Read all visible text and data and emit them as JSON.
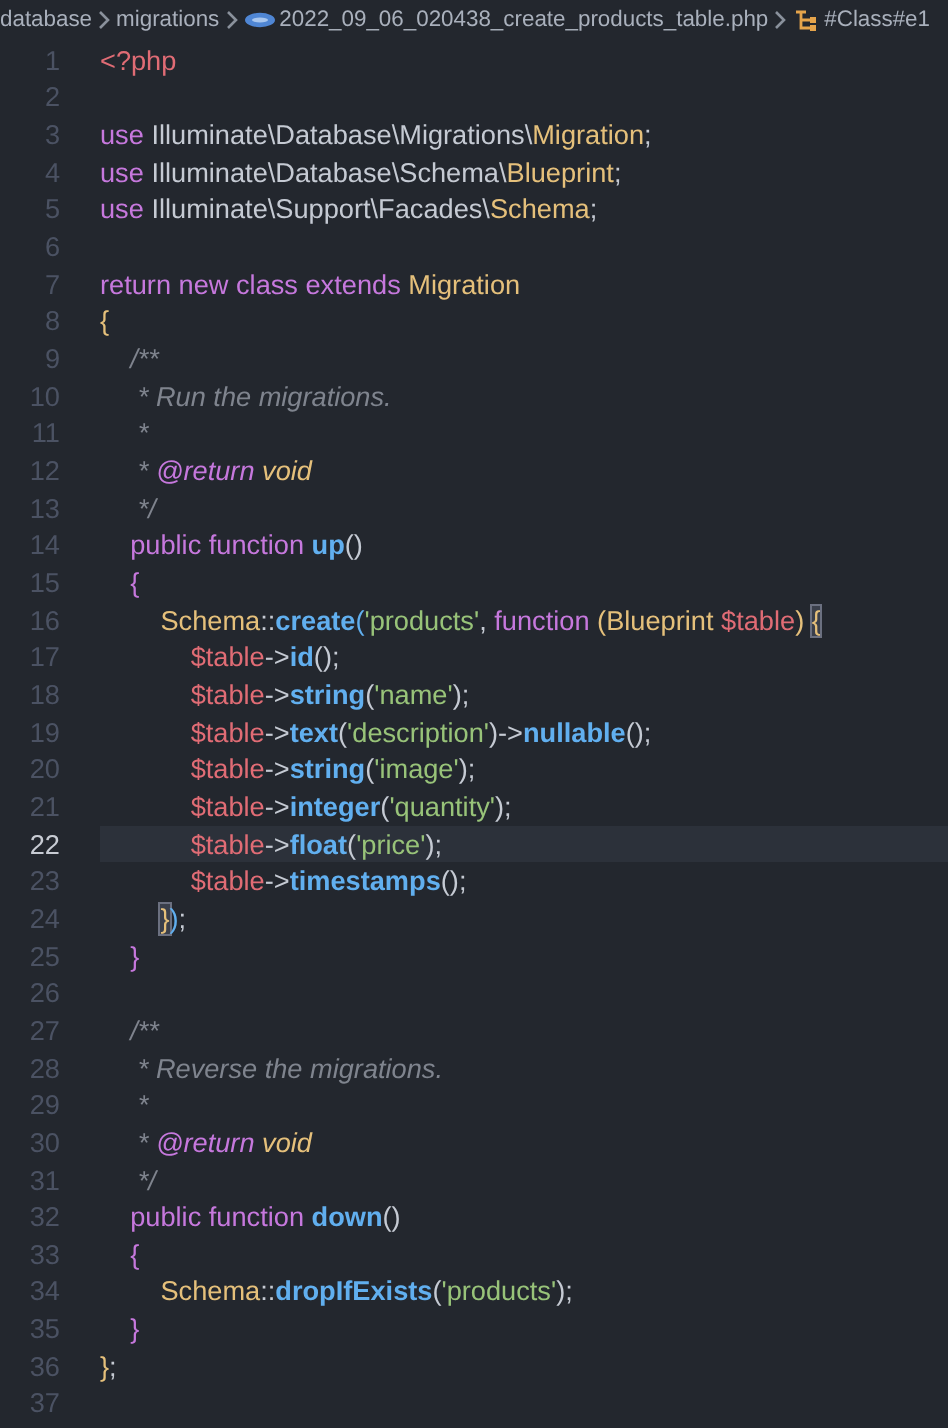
{
  "breadcrumb": [
    {
      "text": "database",
      "kind": "folder"
    },
    {
      "text": "migrations",
      "kind": "folder"
    },
    {
      "text": "2022_09_06_020438_create_products_table.php",
      "kind": "file"
    },
    {
      "text": "#Class#e1",
      "kind": "symbol"
    }
  ],
  "lines": [
    {
      "number": "1",
      "current": false,
      "tokens": [
        {
          "text": "<?php",
          "kind": "tag"
        }
      ]
    },
    {
      "number": "2",
      "current": false
    },
    {
      "number": "3",
      "current": false,
      "tokens": [
        {
          "text": "use",
          "kind": "kw"
        },
        {
          "text": " Illuminate\\Database\\Migrations\\",
          "kind": "plain"
        },
        {
          "text": "Migration",
          "kind": "cls"
        },
        {
          "text": ";",
          "kind": "plain"
        }
      ]
    },
    {
      "number": "4",
      "current": false,
      "tokens": [
        {
          "text": "use",
          "kind": "kw"
        },
        {
          "text": " Illuminate\\Database\\Schema\\",
          "kind": "plain"
        },
        {
          "text": "Blueprint",
          "kind": "cls"
        },
        {
          "text": ";",
          "kind": "plain"
        }
      ]
    },
    {
      "number": "5",
      "current": false,
      "tokens": [
        {
          "text": "use",
          "kind": "kw"
        },
        {
          "text": " Illuminate\\Support\\Facades\\",
          "kind": "plain"
        },
        {
          "text": "Schema",
          "kind": "cls"
        },
        {
          "text": ";",
          "kind": "plain"
        }
      ]
    },
    {
      "number": "6",
      "current": false
    },
    {
      "number": "7",
      "current": false,
      "tokens": [
        {
          "text": "return new class extends",
          "kind": "kw"
        },
        {
          "text": " Migration",
          "kind": "cls"
        }
      ]
    },
    {
      "number": "8",
      "current": false,
      "tokens": [
        {
          "text": "{",
          "kind": "b1"
        }
      ]
    },
    {
      "number": "9",
      "current": false,
      "tokens": [
        {
          "text": "    /**",
          "kind": "cmt"
        }
      ]
    },
    {
      "number": "10",
      "current": false,
      "tokens": [
        {
          "text": "     * Run the migrations.",
          "kind": "cmt"
        }
      ]
    },
    {
      "number": "11",
      "current": false,
      "tokens": [
        {
          "text": "     *",
          "kind": "cmt"
        }
      ]
    },
    {
      "number": "12",
      "current": false,
      "tokens": [
        {
          "text": "     * ",
          "kind": "cmt"
        },
        {
          "text": "@return",
          "kind": "ann"
        },
        {
          "text": " void",
          "kind": "typ"
        }
      ]
    },
    {
      "number": "13",
      "current": false,
      "tokens": [
        {
          "text": "     */",
          "kind": "cmt"
        }
      ]
    },
    {
      "number": "14",
      "current": false,
      "tokens": [
        {
          "text": "    public function",
          "kind": "kw"
        },
        {
          "text": " up",
          "kind": "fn"
        },
        {
          "text": "()",
          "kind": "plain"
        }
      ]
    },
    {
      "number": "15",
      "current": false,
      "tokens": [
        {
          "text": "    {",
          "kind": "b2"
        }
      ]
    },
    {
      "number": "16",
      "current": false,
      "tokens": [
        {
          "text": "        Schema",
          "kind": "cls"
        },
        {
          "text": "::",
          "kind": "plain"
        },
        {
          "text": "create",
          "kind": "fn"
        },
        {
          "text": "(",
          "kind": "b3"
        },
        {
          "text": "'products'",
          "kind": "str"
        },
        {
          "text": ", ",
          "kind": "plain"
        },
        {
          "text": "function ",
          "kind": "kw"
        },
        {
          "text": "(",
          "kind": "b1"
        },
        {
          "text": "Blueprint ",
          "kind": "cls"
        },
        {
          "text": "$table",
          "kind": "var"
        },
        {
          "text": ") ",
          "kind": "b1"
        },
        {
          "text": "{",
          "kind": "match"
        }
      ]
    },
    {
      "number": "17",
      "current": false,
      "tokens": [
        {
          "text": "            $table",
          "kind": "var"
        },
        {
          "text": "->",
          "kind": "plain"
        },
        {
          "text": "id",
          "kind": "fn"
        },
        {
          "text": "();",
          "kind": "plain"
        }
      ]
    },
    {
      "number": "18",
      "current": false,
      "tokens": [
        {
          "text": "            $table",
          "kind": "var"
        },
        {
          "text": "->",
          "kind": "plain"
        },
        {
          "text": "string",
          "kind": "fn"
        },
        {
          "text": "(",
          "kind": "plain"
        },
        {
          "text": "'name'",
          "kind": "str"
        },
        {
          "text": ");",
          "kind": "plain"
        }
      ]
    },
    {
      "number": "19",
      "current": false,
      "tokens": [
        {
          "text": "            $table",
          "kind": "var"
        },
        {
          "text": "->",
          "kind": "plain"
        },
        {
          "text": "text",
          "kind": "fn"
        },
        {
          "text": "(",
          "kind": "plain"
        },
        {
          "text": "'description'",
          "kind": "str"
        },
        {
          "text": ")->",
          "kind": "plain"
        },
        {
          "text": "nullable",
          "kind": "fn"
        },
        {
          "text": "();",
          "kind": "plain"
        }
      ]
    },
    {
      "number": "20",
      "current": false,
      "tokens": [
        {
          "text": "            $table",
          "kind": "var"
        },
        {
          "text": "->",
          "kind": "plain"
        },
        {
          "text": "string",
          "kind": "fn"
        },
        {
          "text": "(",
          "kind": "plain"
        },
        {
          "text": "'image'",
          "kind": "str"
        },
        {
          "text": ");",
          "kind": "plain"
        }
      ]
    },
    {
      "number": "21",
      "current": false,
      "tokens": [
        {
          "text": "            $table",
          "kind": "var"
        },
        {
          "text": "->",
          "kind": "plain"
        },
        {
          "text": "integer",
          "kind": "fn"
        },
        {
          "text": "(",
          "kind": "plain"
        },
        {
          "text": "'quantity'",
          "kind": "str"
        },
        {
          "text": ");",
          "kind": "plain"
        }
      ]
    },
    {
      "number": "22",
      "current": true,
      "tokens": [
        {
          "text": "            $table",
          "kind": "var"
        },
        {
          "text": "->",
          "kind": "plain"
        },
        {
          "text": "float",
          "kind": "fn"
        },
        {
          "text": "(",
          "kind": "plain"
        },
        {
          "text": "'price'",
          "kind": "str"
        },
        {
          "text": ");",
          "kind": "plain"
        }
      ]
    },
    {
      "number": "23",
      "current": false,
      "tokens": [
        {
          "text": "            $table",
          "kind": "var"
        },
        {
          "text": "->",
          "kind": "plain"
        },
        {
          "text": "timestamps",
          "kind": "fn"
        },
        {
          "text": "();",
          "kind": "plain"
        }
      ]
    },
    {
      "number": "24",
      "current": false,
      "tokens": [
        {
          "text": "        }",
          "kind": "match"
        },
        {
          "text": ")",
          "kind": "b3"
        },
        {
          "text": ";",
          "kind": "plain"
        }
      ]
    },
    {
      "number": "25",
      "current": false,
      "tokens": [
        {
          "text": "    }",
          "kind": "b2"
        }
      ]
    },
    {
      "number": "26",
      "current": false
    },
    {
      "number": "27",
      "current": false,
      "tokens": [
        {
          "text": "    /**",
          "kind": "cmt"
        }
      ]
    },
    {
      "number": "28",
      "current": false,
      "tokens": [
        {
          "text": "     * Reverse the migrations.",
          "kind": "cmt"
        }
      ]
    },
    {
      "number": "29",
      "current": false,
      "tokens": [
        {
          "text": "     *",
          "kind": "cmt"
        }
      ]
    },
    {
      "number": "30",
      "current": false,
      "tokens": [
        {
          "text": "     * ",
          "kind": "cmt"
        },
        {
          "text": "@return",
          "kind": "ann"
        },
        {
          "text": " void",
          "kind": "typ"
        }
      ]
    },
    {
      "number": "31",
      "current": false,
      "tokens": [
        {
          "text": "     */",
          "kind": "cmt"
        }
      ]
    },
    {
      "number": "32",
      "current": false,
      "tokens": [
        {
          "text": "    public function",
          "kind": "kw"
        },
        {
          "text": " down",
          "kind": "fn"
        },
        {
          "text": "()",
          "kind": "plain"
        }
      ]
    },
    {
      "number": "33",
      "current": false,
      "tokens": [
        {
          "text": "    {",
          "kind": "b2"
        }
      ]
    },
    {
      "number": "34",
      "current": false,
      "tokens": [
        {
          "text": "        Schema",
          "kind": "cls"
        },
        {
          "text": "::",
          "kind": "plain"
        },
        {
          "text": "dropIfExists",
          "kind": "fn"
        },
        {
          "text": "(",
          "kind": "plain"
        },
        {
          "text": "'products'",
          "kind": "str"
        },
        {
          "text": ");",
          "kind": "plain"
        }
      ]
    },
    {
      "number": "35",
      "current": false,
      "tokens": [
        {
          "text": "    }",
          "kind": "b2"
        }
      ]
    },
    {
      "number": "36",
      "current": false,
      "tokens": [
        {
          "text": "}",
          "kind": "b1"
        },
        {
          "text": ";",
          "kind": "plain"
        }
      ]
    },
    {
      "number": "37",
      "current": false
    }
  ]
}
